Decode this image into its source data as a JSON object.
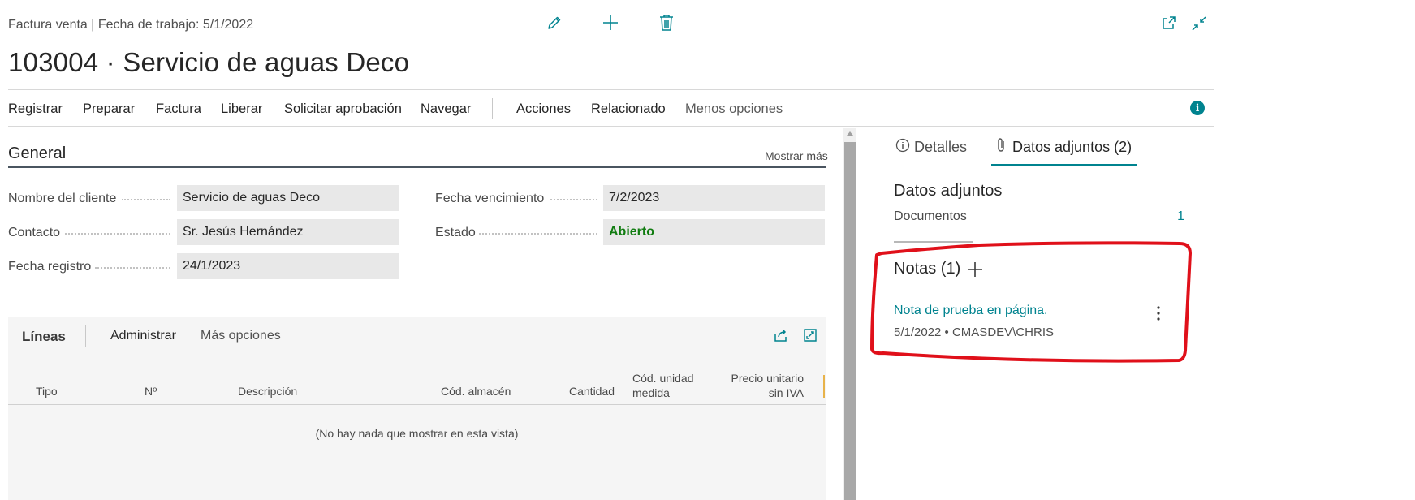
{
  "header": {
    "caption": "Factura venta | Fecha de trabajo: 5/1/2022",
    "title": "103004 · Servicio de aguas Deco",
    "icons": [
      "edit-icon",
      "add-icon",
      "delete-icon",
      "open-new-window-icon",
      "collapse-icon"
    ]
  },
  "actions": {
    "items": [
      "Registrar",
      "Preparar",
      "Factura",
      "Liberar",
      "Solicitar aprobación",
      "Navegar",
      "Acciones",
      "Relacionado",
      "Menos opciones"
    ]
  },
  "general": {
    "title": "General",
    "show_more": "Mostrar más",
    "fields": {
      "customer_name": {
        "label": "Nombre del cliente",
        "value": "Servicio de aguas Deco"
      },
      "contact": {
        "label": "Contacto",
        "value": "Sr. Jesús Hernández"
      },
      "posting_date": {
        "label": "Fecha registro",
        "value": "24/1/2023"
      },
      "due_date": {
        "label": "Fecha vencimiento",
        "value": "7/2/2023"
      },
      "status": {
        "label": "Estado",
        "value": "Abierto"
      }
    }
  },
  "lines": {
    "title": "Líneas",
    "manage": "Administrar",
    "more_options": "Más opciones",
    "columns": {
      "type": "Tipo",
      "no": "Nº",
      "description": "Descripción",
      "location": "Cód. almacén",
      "quantity": "Cantidad",
      "uom_1": "Cód. unidad",
      "uom_2": "medida",
      "price_1": "Precio unitario",
      "price_2": "sin IVA"
    },
    "empty_text": "(No hay nada que mostrar en esta vista)"
  },
  "factbox": {
    "tab_details": "Detalles",
    "tab_attachments": "Datos adjuntos (2)",
    "attachments_title": "Datos adjuntos",
    "documents_label": "Documentos",
    "documents_count": "1",
    "notes_title": "Notas (1)",
    "note_text": "Nota de prueba en página.",
    "note_meta": "5/1/2022 • CMASDEV\\CHRIS"
  },
  "colors": {
    "accent": "#00838f",
    "status_open": "#107c10",
    "highlight_annotation": "#e0101a"
  }
}
